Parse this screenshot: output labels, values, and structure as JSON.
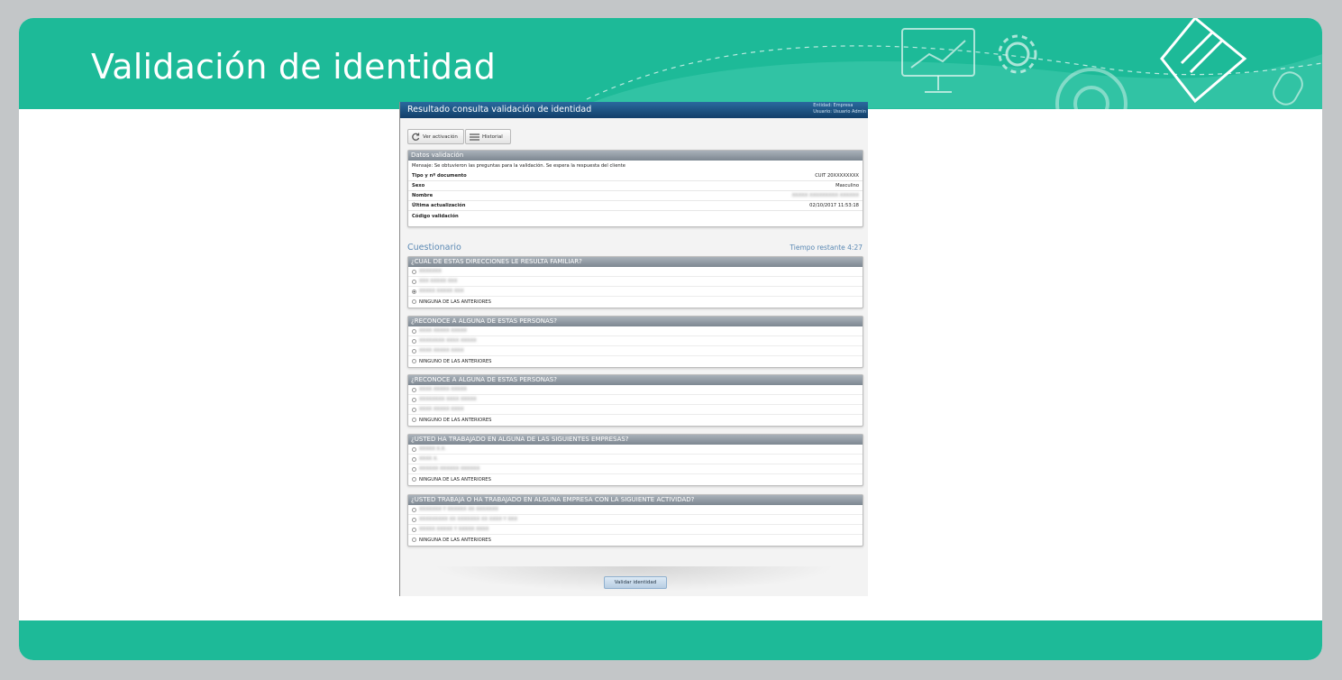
{
  "colors": {
    "brand": "#1dba98",
    "app_header": "#1d5185",
    "question_header": "#8a939c",
    "accent_text": "#5b89b4"
  },
  "slide": {
    "title": "Validación de identidad"
  },
  "app": {
    "title": "Resultado consulta validación de identidad",
    "entity": "Entidad: Empresa",
    "user": "Usuario: Usuario Admin",
    "toolbar": {
      "ver_activacion": "Ver activación",
      "historial": "Historial"
    },
    "datos": {
      "header": "Datos validación",
      "mensaje_label": "Mensaje:",
      "mensaje": "Se obtuvieron las preguntas para la validación. Se espera la respuesta del cliente",
      "rows": [
        {
          "label": "Tipo y nº documento",
          "value": "CUIT 20XXXXXXXX"
        },
        {
          "label": "Sexo",
          "value": "Masculino"
        },
        {
          "label": "Nombre",
          "value": "XXXXX XXXXXXXXX XXXXXX"
        },
        {
          "label": "Última actualización",
          "value": "02/10/2017 11:53:18"
        },
        {
          "label": "Código validación",
          "value": ""
        }
      ]
    },
    "cuestionario": {
      "title": "Cuestionario",
      "time": "Tiempo restante 4:27",
      "questions": [
        {
          "q": "¿CUAL DE ESTAS DIRECCIONES LE RESULTA FAMILIAR?",
          "opts": [
            "XXXXXXX",
            "XXX XXXXX XXX",
            "XXXXX XXXXX XXX"
          ],
          "none": "NINGUNA DE LAS ANTERIORES"
        },
        {
          "q": "¿RECONOCE A ALGUNA DE ESTAS PERSONAS?",
          "opts": [
            "XXXX XXXXX XXXXX",
            "XXXXXXXX XXXX XXXXX",
            "XXXX XXXXX XXXX"
          ],
          "none": "NINGUNO DE LAS ANTERIORES"
        },
        {
          "q": "¿RECONOCE A ALGUNA DE ESTAS PERSONAS?",
          "opts": [
            "XXXX XXXXX XXXXX",
            "XXXXXXXX XXXX XXXXX",
            "XXXX XXXXX XXXX"
          ],
          "none": "NINGUNO DE LAS ANTERIORES"
        },
        {
          "q": "¿USTED HA TRABAJADO EN ALGUNA DE LAS SIGUIENTES EMPRESAS?",
          "opts": [
            "XXXXX X.X.",
            "XXXX X.",
            "XXXXXX XXXXXX XXXXXX"
          ],
          "none": "NINGUNA DE LAS ANTERIORES"
        },
        {
          "q": "¿USTED TRABAJA O HA TRABAJADO EN ALGUNA EMPRESA CON LA SIGUIENTE ACTIVIDAD?",
          "opts": [
            "XXXXXXX Y XXXXXX XX XXXXXXX",
            "XXXXXXXXX XX XXXXXXX XX XXXX Y XXX",
            "XXXXX XXXXX Y XXXXX XXXX"
          ],
          "none": "NINGUNA DE LAS ANTERIORES"
        }
      ]
    },
    "validate_button": "Validar identidad"
  }
}
